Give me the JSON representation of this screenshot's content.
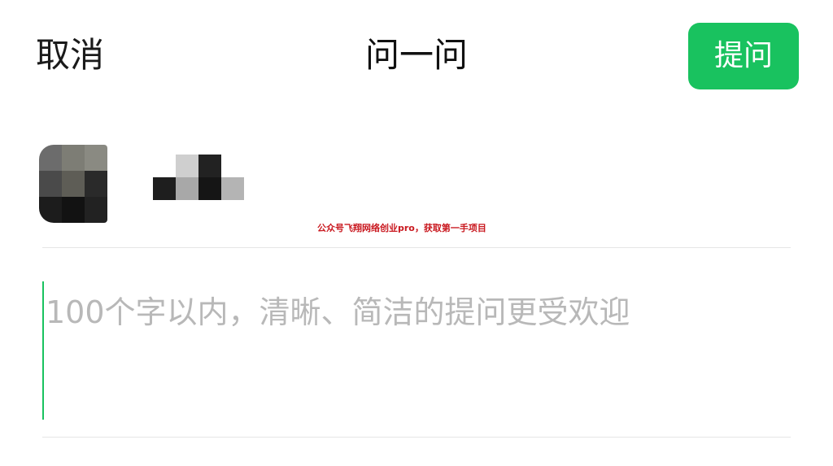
{
  "header": {
    "cancel_label": "取消",
    "title": "问一问",
    "submit_label": "提问"
  },
  "user": {
    "avatar_pixels": [
      "#6c6c6c",
      "#7d7d75",
      "#8a8a82",
      "#4a4a4a",
      "#5e5d56",
      "#2a2a2a",
      "#1c1c1c",
      "#121212",
      "#222222"
    ],
    "name_pixels": [
      "#ffffff",
      "#cfcfcf",
      "#222222",
      "#ffffff",
      "#1e1e1e",
      "#a8a8a8",
      "#151515",
      "#b4b4b4"
    ]
  },
  "watermark": "公众号飞翔网络创业pro，获取第一手项目",
  "question": {
    "value": "",
    "placeholder": "100个字以内，清晰、简洁的提问更受欢迎"
  },
  "colors": {
    "accent": "#19c25f",
    "watermark": "#c9181f"
  }
}
